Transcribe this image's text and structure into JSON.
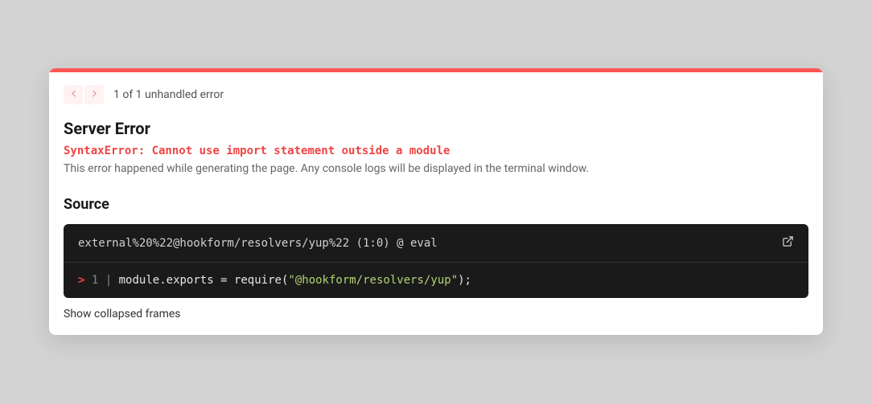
{
  "nav": {
    "counter": "1 of 1 unhandled error"
  },
  "error": {
    "title": "Server Error",
    "message": "SyntaxError: Cannot use import statement outside a module",
    "description": "This error happened while generating the page. Any console logs will be displayed in the terminal window."
  },
  "source": {
    "title": "Source",
    "location": "external%20%22@hookform/resolvers/yup%22 (1:0) @ eval",
    "code": {
      "marker": ">",
      "lineNum": "1",
      "sep": "|",
      "p1": "module",
      "dot1": ".",
      "p2": "exports",
      "eq": " = ",
      "p3": "require",
      "open": "(",
      "str": "\"@hookform/resolvers/yup\"",
      "close": ");"
    }
  },
  "actions": {
    "showFrames": "Show collapsed frames"
  }
}
